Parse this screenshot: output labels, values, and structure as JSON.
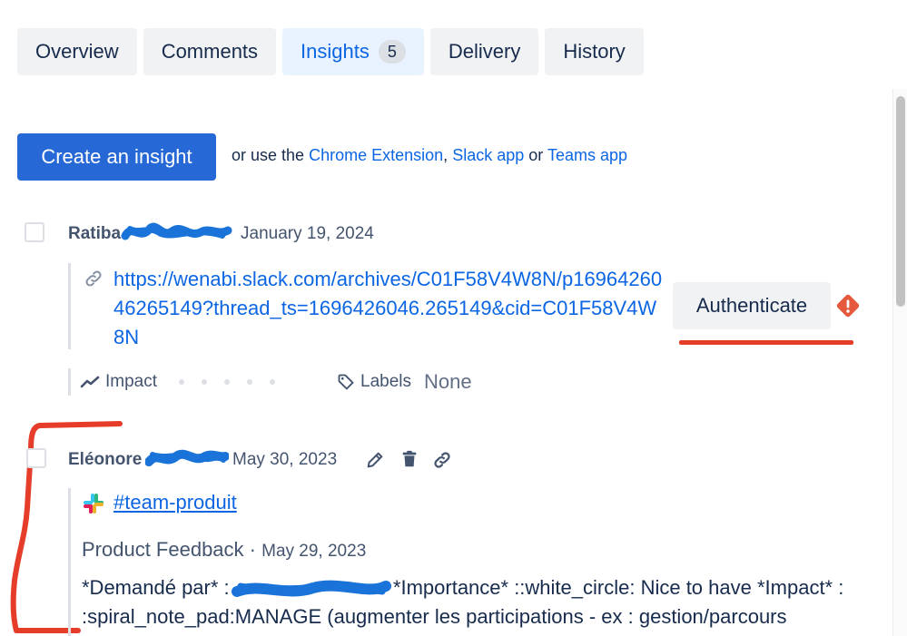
{
  "tabs": [
    {
      "label": "Overview"
    },
    {
      "label": "Comments"
    },
    {
      "label": "Insights",
      "count": "5"
    },
    {
      "label": "Delivery"
    },
    {
      "label": "History"
    }
  ],
  "create": {
    "button_label": "Create an insight",
    "or_use": "or use the",
    "chrome": "Chrome Extension",
    "comma": ",",
    "slack": "Slack app",
    "or": "or",
    "teams": "Teams app"
  },
  "insight1": {
    "author": "Ratiba",
    "date": "January 19, 2024",
    "url": "https://wenabi.slack.com/archives/C01F58V4W8N/p1696426046265149?thread_ts=1696426046.265149&cid=C01F58V4W8N",
    "authenticate": "Authenticate",
    "impact_label": "Impact",
    "labels_label": "Labels",
    "labels_value": "None"
  },
  "insight2": {
    "author": "Eléonore",
    "date": "May 30, 2023",
    "channel": "#team-produit",
    "feedback_title": "Product Feedback",
    "feedback_sep": "·",
    "feedback_date": "May 29, 2023",
    "body_part1": "*Demandé par* :",
    "body_part2": "*Importance* ::white_circle: Nice to have *Impact* : :spiral_note_pad:MANAGE (augmenter les participations - ex : gestion/parcours"
  },
  "colors": {
    "primary": "#2568d6",
    "link": "#0c66e4",
    "annotation_red": "#e53d2a",
    "redaction_blue": "#1a73d9",
    "warning": "#e5593c"
  }
}
